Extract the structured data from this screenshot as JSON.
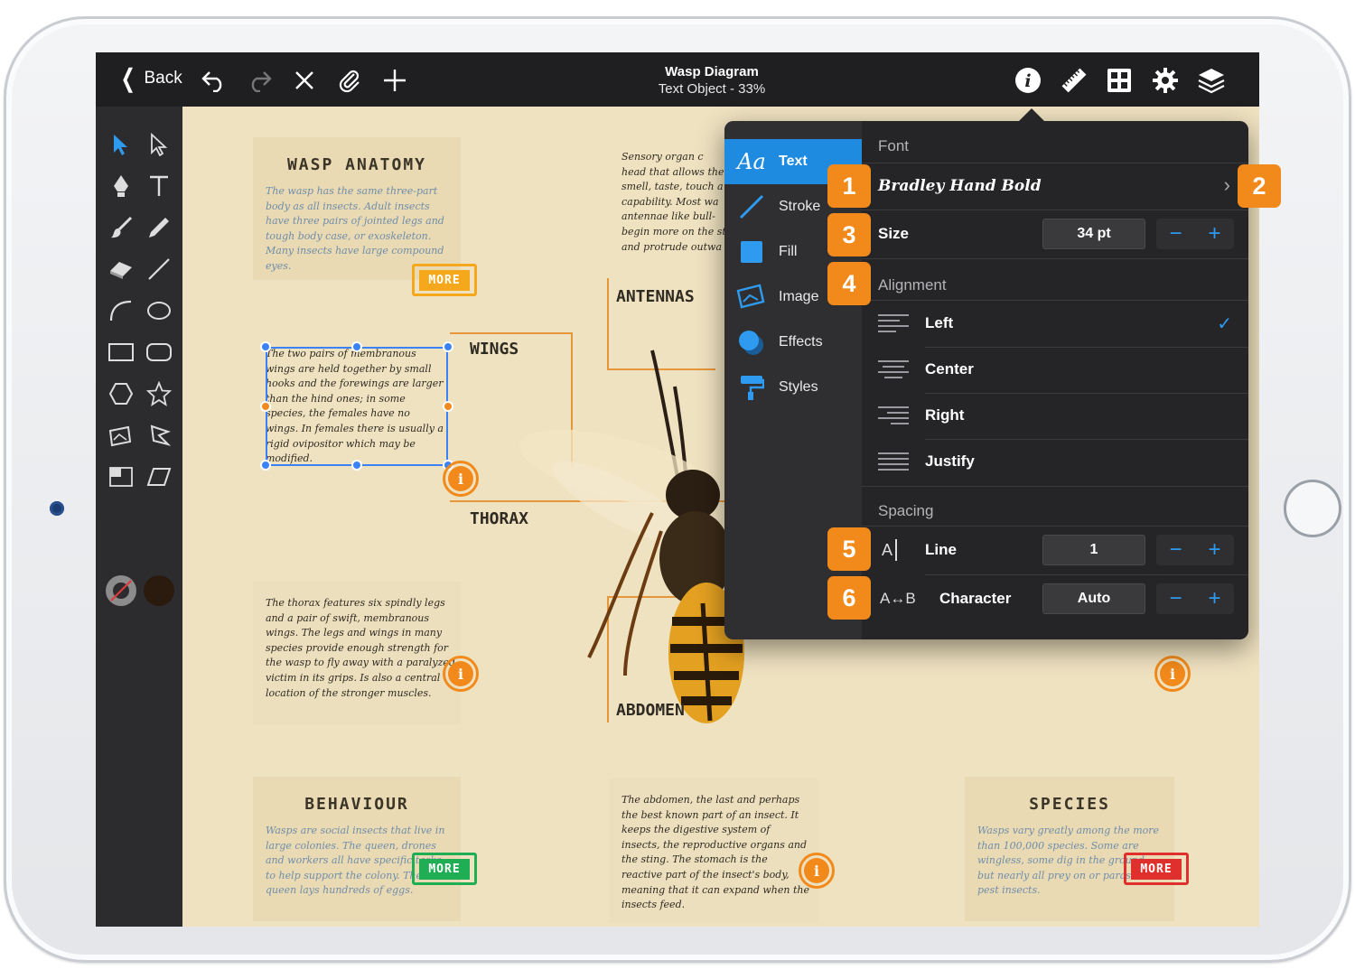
{
  "topbar": {
    "back_label": "Back",
    "doc_title": "Wasp Diagram",
    "doc_subtitle": "Text Object - 33%"
  },
  "canvas": {
    "cards": {
      "anatomy": {
        "title": "WASP ANATOMY",
        "body": "The wasp has the same three-part body as all insects. Adult insects have three pairs of jointed legs and tough body case, or exoskeleton. Many insects have large compound eyes.",
        "more": "MORE"
      },
      "behaviour": {
        "title": "BEHAVIOUR",
        "body": "Wasps are social insects that live in large colonies. The queen, drones and workers all have specific tasks to help support the colony. The queen lays hundreds of eggs.",
        "more": "MORE"
      },
      "species": {
        "title": "SPECIES",
        "body": "Wasps vary greatly among the more than 100,000 species. Some are wingless, some dig in the ground, but nearly all prey on or parasitize pest insects.",
        "more": "MORE"
      }
    },
    "notes": {
      "wings": "The two pairs of membranous wings are held together by small hooks and the forewings are larger than the hind ones; in some species, the females have no wings. In females there is usually a rigid ovipositor which may be modified.",
      "thorax": "The thorax features six spindly legs and a pair of swift, membranous wings. The legs and wings in many species provide enough strength for the wasp to fly away with a paralyzed victim in its grips. Is also a central location of the stronger muscles.",
      "abdomen": "The abdomen, the last and perhaps the best known part of an insect. It keeps the digestive system of insects, the reproductive organs and the sting. The stomach is the reactive part of the insect's body, meaning that it can expand when the insects feed.",
      "antennas": "Sensory organ c head that allows the smell, taste, touch a capability. Most wa antennae like bull- begin more on the st and protrude outwa"
    },
    "labels": {
      "wings": "WINGS",
      "thorax": "THORAX",
      "antennas": "ANTENNAS",
      "abdomen": "ABDOMEN"
    },
    "info_glyph": "i",
    "colors": {
      "more_anatomy": "#f6a81c",
      "more_behaviour": "#1fae54",
      "more_species": "#e0302d",
      "accent_orange": "#f28a1b"
    }
  },
  "popover": {
    "tabs": [
      {
        "label": "Text",
        "icon": "text-aa-icon",
        "glyph": "Aa"
      },
      {
        "label": "Stroke",
        "icon": "stroke-icon"
      },
      {
        "label": "Fill",
        "icon": "fill-icon"
      },
      {
        "label": "Image",
        "icon": "image-icon"
      },
      {
        "label": "Effects",
        "icon": "effects-icon"
      },
      {
        "label": "Styles",
        "icon": "styles-icon"
      }
    ],
    "font": {
      "header": "Font",
      "value": "Bradley Hand Bold"
    },
    "size": {
      "label": "Size",
      "value": "34 pt"
    },
    "alignment": {
      "header": "Alignment",
      "options": [
        "Left",
        "Center",
        "Right",
        "Justify"
      ],
      "selected": "Left"
    },
    "spacing": {
      "header": "Spacing",
      "line": {
        "label": "Line",
        "value": "1",
        "icon_text": "A"
      },
      "character": {
        "label": "Character",
        "value": "Auto",
        "icon_text": "A↔B"
      }
    },
    "stepper": {
      "minus": "−",
      "plus": "+"
    }
  },
  "badges": [
    "1",
    "2",
    "3",
    "4",
    "5",
    "6"
  ]
}
